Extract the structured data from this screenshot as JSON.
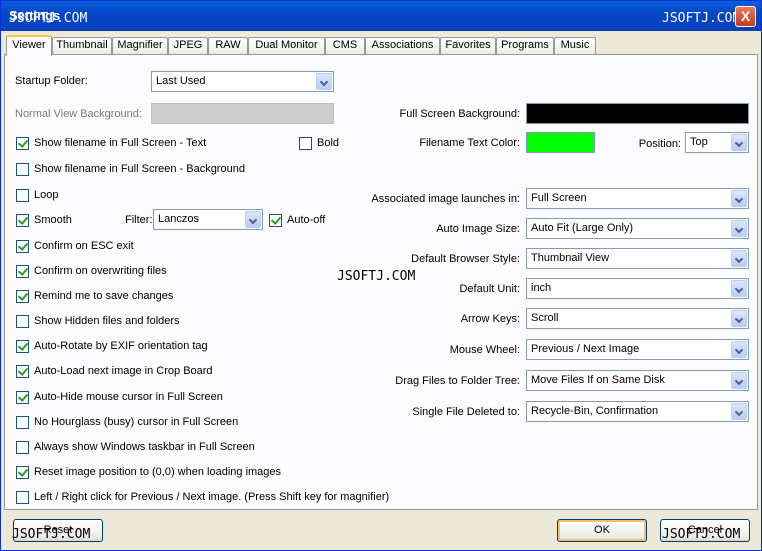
{
  "window": {
    "title": "Settings",
    "close_glyph": "X"
  },
  "watermark": "JSOFTJ.COM",
  "tabs": [
    {
      "label": "Viewer",
      "active": true
    },
    {
      "label": "Thumbnail"
    },
    {
      "label": "Magnifier"
    },
    {
      "label": "JPEG"
    },
    {
      "label": "RAW"
    },
    {
      "label": "Dual Monitor"
    },
    {
      "label": "CMS"
    },
    {
      "label": "Associations"
    },
    {
      "label": "Favorites"
    },
    {
      "label": "Programs"
    },
    {
      "label": "Music"
    }
  ],
  "left": {
    "startup_folder_label": "Startup Folder:",
    "startup_folder_value": "Last Used",
    "normal_view_bg_label": "Normal View Background:",
    "normal_view_bg_color": "#cccccc",
    "show_filename_text": {
      "label": "Show filename in Full Screen - Text",
      "checked": true
    },
    "bold": {
      "label": "Bold",
      "checked": false
    },
    "show_filename_bg": {
      "label": "Show filename in Full Screen - Background",
      "checked": false
    },
    "loop": {
      "label": "Loop",
      "checked": false
    },
    "smooth": {
      "label": "Smooth",
      "checked": true
    },
    "filter_label": "Filter:",
    "filter_value": "Lanczos",
    "auto_off": {
      "label": "Auto-off",
      "checked": true
    },
    "confirm_esc": {
      "label": "Confirm on ESC exit",
      "checked": true
    },
    "confirm_overwrite": {
      "label": "Confirm on overwriting files",
      "checked": true
    },
    "remind_save": {
      "label": "Remind me to save changes",
      "checked": true
    },
    "show_hidden": {
      "label": "Show Hidden files and folders",
      "checked": false
    },
    "auto_rotate": {
      "label": "Auto-Rotate by EXIF orientation tag",
      "checked": true
    },
    "auto_load": {
      "label": "Auto-Load next image in Crop Board",
      "checked": true
    },
    "auto_hide": {
      "label": "Auto-Hide mouse cursor in Full Screen",
      "checked": true
    },
    "no_hourglass": {
      "label": "No Hourglass (busy) cursor in Full Screen",
      "checked": false
    },
    "always_taskbar": {
      "label": "Always show Windows taskbar in Full Screen",
      "checked": false
    },
    "reset_position": {
      "label": "Reset image position to (0,0) when loading images",
      "checked": true
    },
    "left_right_click": {
      "label": "Left / Right click for Previous / Next image. (Press Shift key for magnifier)",
      "checked": false
    }
  },
  "right": {
    "full_screen_bg_label": "Full Screen Background:",
    "full_screen_bg_color": "#000000",
    "filename_color_label": "Filename Text Color:",
    "filename_color": "#00ff00",
    "position_label": "Position:",
    "position_value": "Top",
    "assoc_label": "Associated image launches in:",
    "assoc_value": "Full Screen",
    "auto_size_label": "Auto Image Size:",
    "auto_size_value": "Auto Fit (Large Only)",
    "browser_style_label": "Default Browser Style:",
    "browser_style_value": "Thumbnail View",
    "unit_label": "Default Unit:",
    "unit_value": "inch",
    "arrow_keys_label": "Arrow Keys:",
    "arrow_keys_value": "Scroll",
    "mouse_wheel_label": "Mouse Wheel:",
    "mouse_wheel_value": "Previous / Next Image",
    "drag_files_label": "Drag Files to Folder Tree:",
    "drag_files_value": "Move Files If on Same Disk",
    "single_deleted_label": "Single File Deleted to:",
    "single_deleted_value": "Recycle-Bin, Confirmation"
  },
  "buttons": {
    "reset": "Reset",
    "ok": "OK",
    "cancel": "Cancel"
  }
}
